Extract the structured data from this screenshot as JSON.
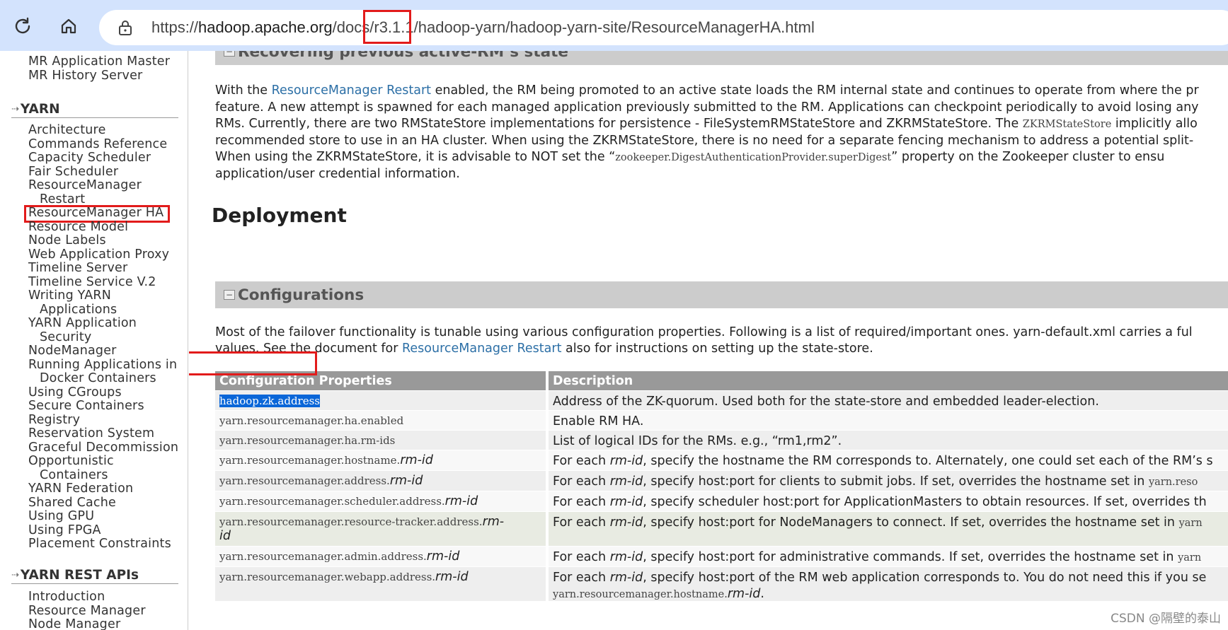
{
  "browser": {
    "url_prefix": "https://",
    "url_host": "hadoop.apache.org",
    "url_path_a": "/docs/",
    "url_version": "r3.1.1",
    "url_path_b": "/hadoop-yarn/hadoop-yarn-site/ResourceManagerHA.html"
  },
  "sidebar": {
    "top_items": [
      "MR Application Master",
      "MR History Server"
    ],
    "yarn_header": "YARN",
    "yarn_items": [
      "Architecture",
      "Commands Reference",
      "Capacity Scheduler",
      "Fair Scheduler",
      "ResourceManager",
      "Restart",
      "ResourceManager HA",
      "Resource Model",
      "Node Labels",
      "Web Application Proxy",
      "Timeline Server",
      "Timeline Service V.2",
      "Writing YARN",
      "Applications",
      "YARN Application",
      "Security",
      "NodeManager",
      "Running Applications in",
      "Docker Containers",
      "Using CGroups",
      "Secure Containers",
      "Registry",
      "Reservation System",
      "Graceful Decommission",
      "Opportunistic",
      "Containers",
      "YARN Federation",
      "Shared Cache",
      "Using GPU",
      "Using FPGA",
      "Placement Constraints"
    ],
    "rest_header": "YARN REST APIs",
    "rest_items": [
      "Introduction",
      "Resource Manager",
      "Node Manager"
    ]
  },
  "main": {
    "recover_title": "Recovering previous active-RM’s state",
    "recover_p": [
      {
        "a": "With the ",
        "link": "ResourceManager Restart",
        "b": " enabled, the RM being promoted to an active state loads the RM internal state and continues to operate from where the pr"
      },
      {
        "a": "feature. A new attempt is spawned for each managed application previously submitted to the RM. Applications can checkpoint periodically to avoid losing any"
      },
      {
        "a": "RMs. Currently, there are two RMStateStore implementations for persistence - FileSystemRMStateStore and ZKRMStateStore. The ",
        "code": "ZKRMStateStore",
        "b": " implicitly allo"
      },
      {
        "a": "recommended store to use in an HA cluster. When using the ZKRMStateStore, there is no need for a separate fencing mechanism to address a potential split-"
      },
      {
        "a": "When using the ZKRMStateStore, it is advisable to NOT set the “",
        "code": "zookeeper.DigestAuthenticationProvider.superDigest",
        "b": "” property on the Zookeeper cluster to ensu"
      },
      {
        "a": "application/user credential information."
      }
    ],
    "deployment_heading": "Deployment",
    "config_title": "Configurations",
    "config_p1": "Most of the failover functionality is tunable using various configuration properties. Following is a list of required/important ones. yarn-default.xml carries a ful",
    "config_p2_a": "values. See the document for ",
    "config_p2_link": "ResourceManager Restart",
    "config_p2_b": " also for instructions on setting up the state-store.",
    "table_headers": [
      "Configuration Properties",
      "Description"
    ],
    "rows": [
      {
        "prop": "hadoop.zk.address",
        "rmid": "",
        "prop2": "",
        "desc_a": "Address of the ZK-quorum. Used both for the state-store and embedded leader-election.",
        "desc_i": "",
        "desc_b": "",
        "desc_code": "",
        "desc2": ""
      },
      {
        "prop": "yarn.resourcemanager.ha.enabled",
        "rmid": "",
        "prop2": "",
        "desc_a": "Enable RM HA.",
        "desc_i": "",
        "desc_b": "",
        "desc_code": "",
        "desc2": ""
      },
      {
        "prop": "yarn.resourcemanager.ha.rm-ids",
        "rmid": "",
        "prop2": "",
        "desc_a": "List of logical IDs for the RMs. e.g., “rm1,rm2”.",
        "desc_i": "",
        "desc_b": "",
        "desc_code": "",
        "desc2": ""
      },
      {
        "prop": "yarn.resourcemanager.hostname.",
        "rmid": "rm-id",
        "prop2": "",
        "desc_a": "For each ",
        "desc_i": "rm-id",
        "desc_b": ", specify the hostname the RM corresponds to. Alternately, one could set each of the RM’s s",
        "desc_code": "",
        "desc2": ""
      },
      {
        "prop": "yarn.resourcemanager.address.",
        "rmid": "rm-id",
        "prop2": "",
        "desc_a": "For each ",
        "desc_i": "rm-id",
        "desc_b": ", specify host:port for clients to submit jobs. If set, overrides the hostname set in ",
        "desc_code": "yarn.reso",
        "desc2": ""
      },
      {
        "prop": "yarn.resourcemanager.scheduler.address.",
        "rmid": "rm-id",
        "prop2": "",
        "desc_a": "For each ",
        "desc_i": "rm-id",
        "desc_b": ", specify scheduler host:port for ApplicationMasters to obtain resources. If set, overrides th",
        "desc_code": "",
        "desc2": ""
      },
      {
        "prop": "yarn.resourcemanager.resource-tracker.address.",
        "rmid": "rm-",
        "prop2": "id",
        "desc_a": "For each ",
        "desc_i": "rm-id",
        "desc_b": ", specify host:port for NodeManagers to connect. If set, overrides the hostname set in ",
        "desc_code": "yarn",
        "desc2": ""
      },
      {
        "prop": "yarn.resourcemanager.admin.address.",
        "rmid": "rm-id",
        "prop2": "",
        "desc_a": "For each ",
        "desc_i": "rm-id",
        "desc_b": ", specify host:port for administrative commands. If set, overrides the hostname set in ",
        "desc_code": "yarn",
        "desc2": ""
      },
      {
        "prop": "yarn.resourcemanager.webapp.address.",
        "rmid": "rm-id",
        "prop2": "",
        "desc_a": "For each ",
        "desc_i": "rm-id",
        "desc_b": ", specify host:port of the RM web application corresponds to. You do not need this if you se",
        "desc_code": "",
        "desc2_code": "yarn.resourcemanager.hostname.",
        "desc2_i": "rm-id",
        "desc2_end": "."
      }
    ]
  },
  "watermark": "CSDN @隔壁的泰山",
  "colors": {
    "toolbar": "#d3e3fd",
    "highlight_box": "#e21b1b",
    "link": "#2c6fa6",
    "selection": "#0a66d8",
    "section_bar": "#cccccc",
    "table_header": "#999999"
  }
}
